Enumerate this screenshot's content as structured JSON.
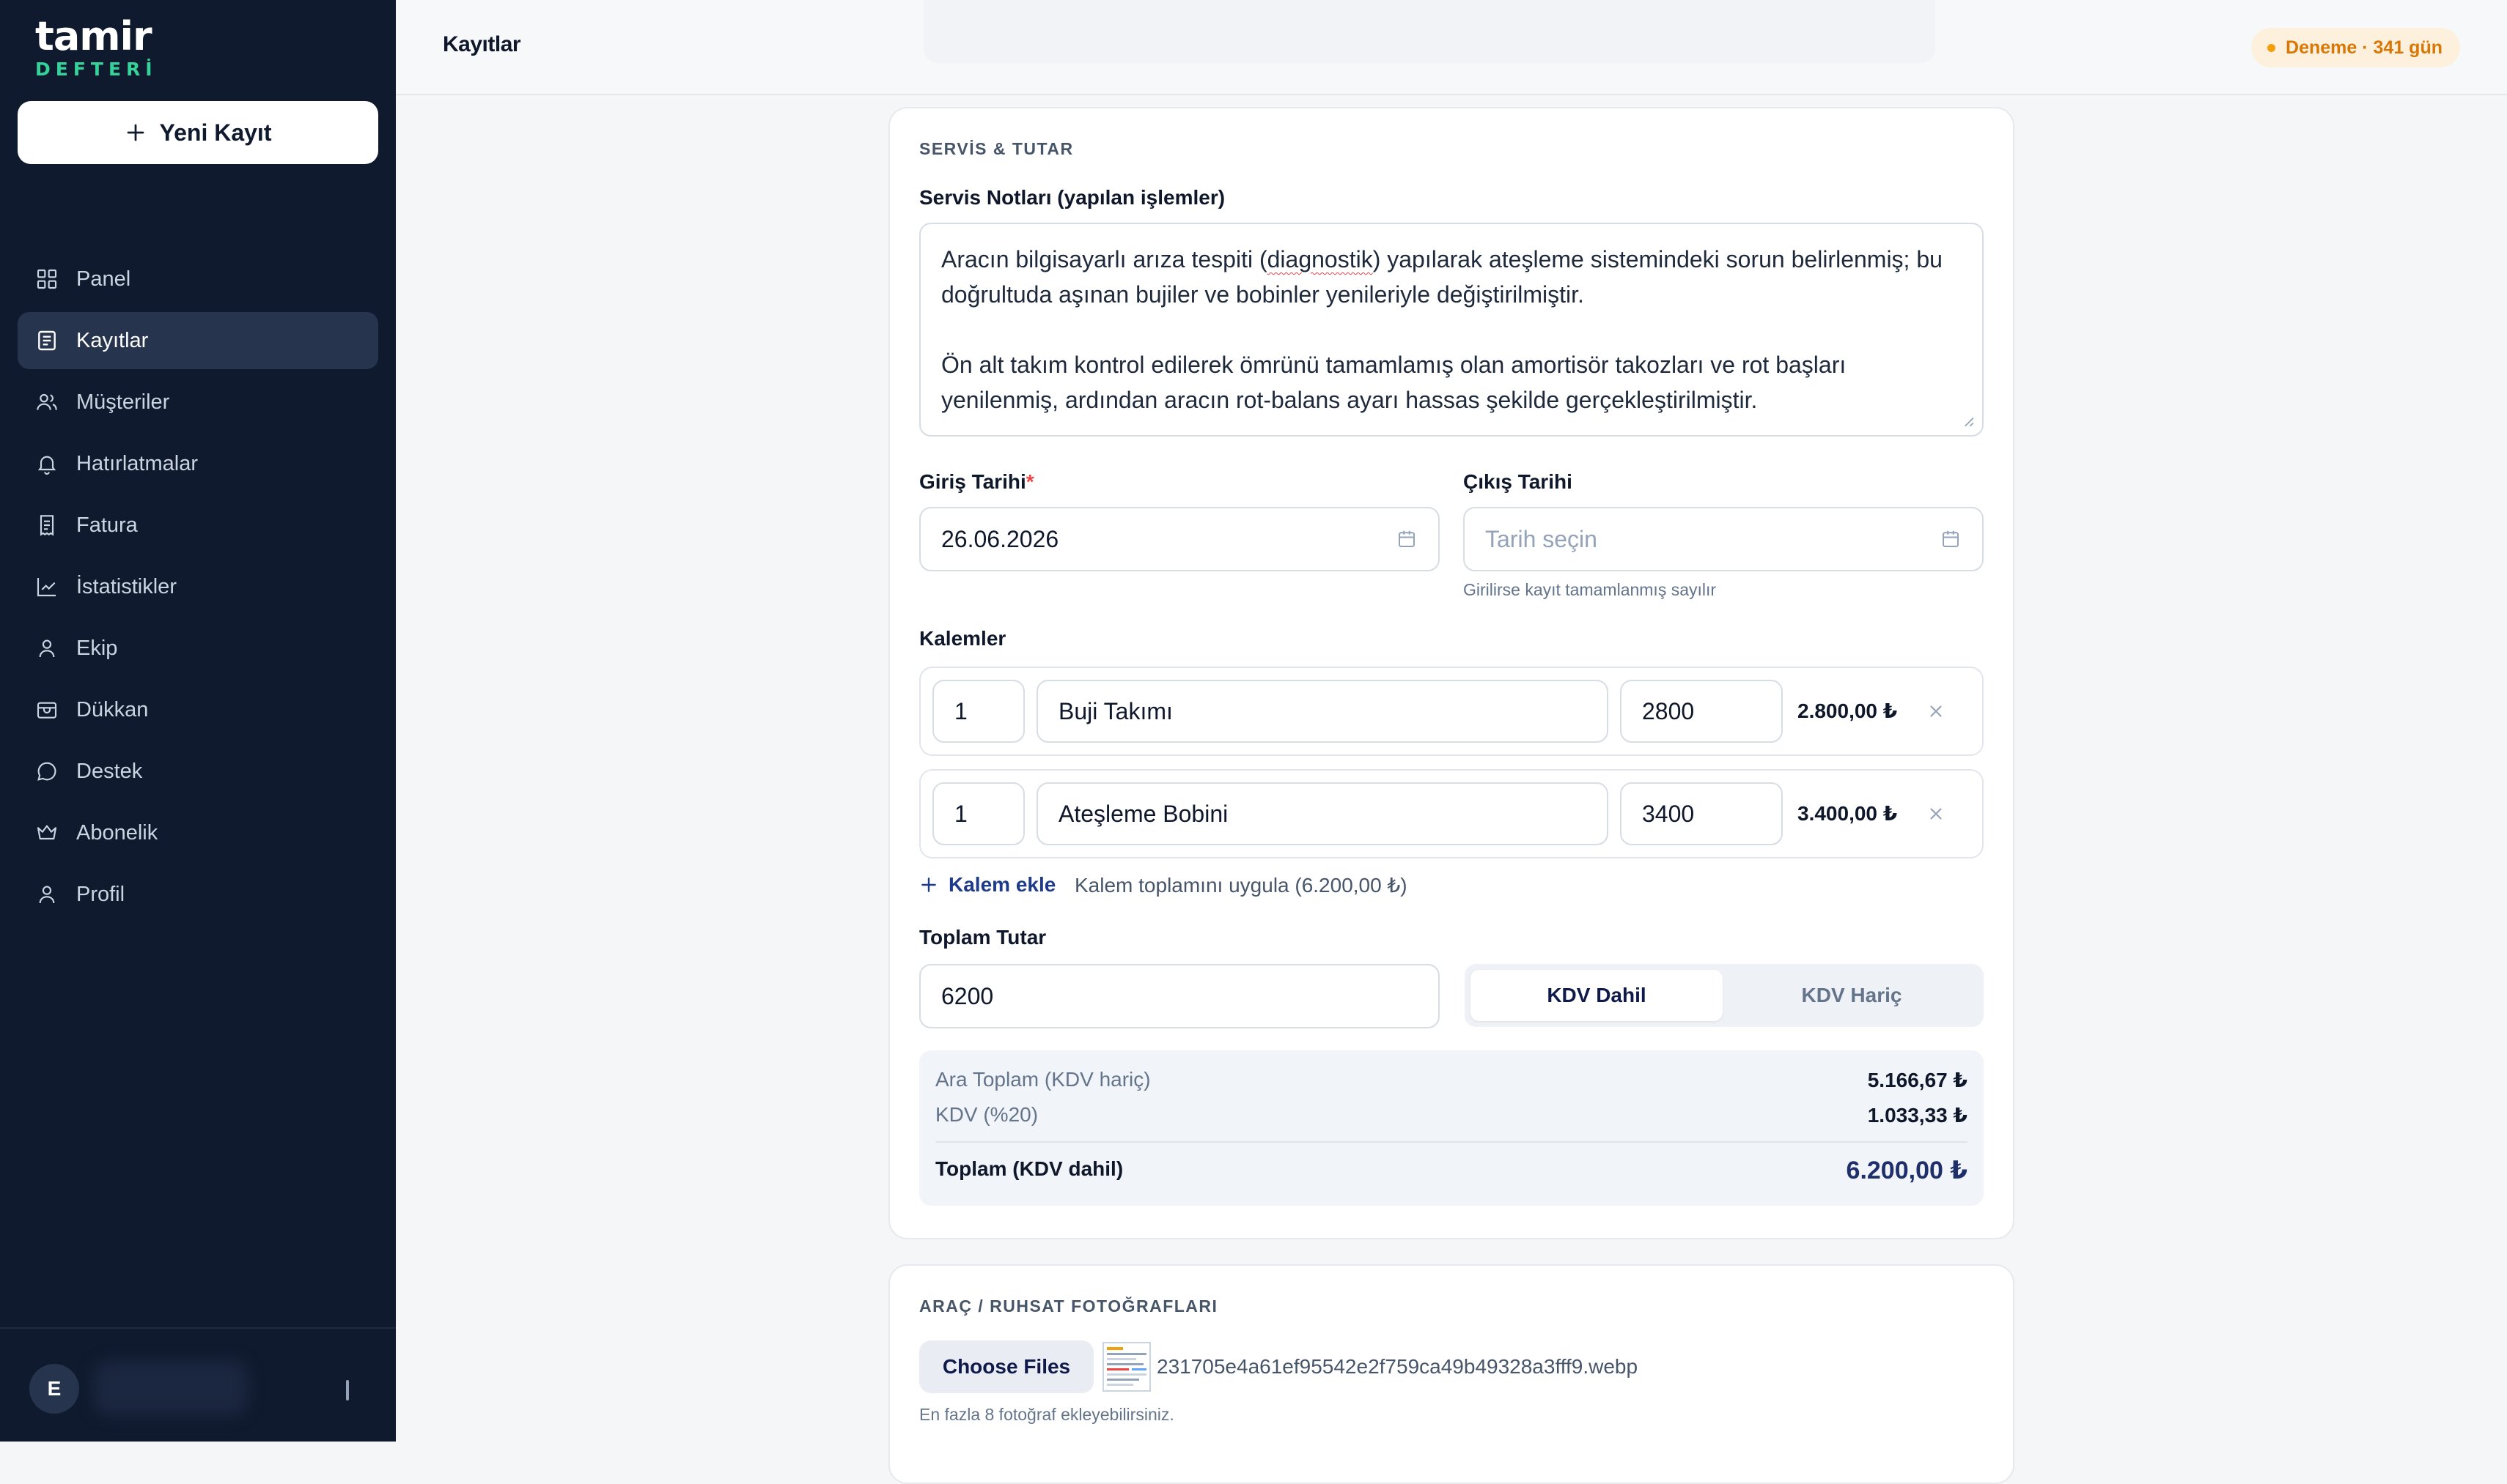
{
  "app": {
    "logo_main": "tamir",
    "logo_sub": "DEFTERİ"
  },
  "sidebar": {
    "new_button": "Yeni Kayıt",
    "items": [
      {
        "label": "Panel",
        "icon": "grid-icon"
      },
      {
        "label": "Kayıtlar",
        "icon": "document-list-icon",
        "active": true
      },
      {
        "label": "Müşteriler",
        "icon": "users-icon"
      },
      {
        "label": "Hatırlatmalar",
        "icon": "bell-icon"
      },
      {
        "label": "Fatura",
        "icon": "receipt-icon"
      },
      {
        "label": "İstatistikler",
        "icon": "chart-line-icon"
      },
      {
        "label": "Ekip",
        "icon": "user-icon"
      },
      {
        "label": "Dükkan",
        "icon": "store-icon"
      },
      {
        "label": "Destek",
        "icon": "chat-bubble-icon"
      },
      {
        "label": "Abonelik",
        "icon": "crown-icon"
      },
      {
        "label": "Profil",
        "icon": "profile-icon"
      }
    ],
    "user_initial": "E"
  },
  "header": {
    "title": "Kayıtlar",
    "trial_badge": "Deneme · 341 gün"
  },
  "service": {
    "section_title": "SERVİS & TUTAR",
    "notes_label": "Servis Notları (yapılan işlemler)",
    "notes_p1_a": "Aracın bilgisayarlı arıza tespiti (",
    "notes_p1_b": "diagnostik",
    "notes_p1_c": ") yapılarak ateşleme sistemindeki sorun belirlenmiş; bu doğrultuda aşınan bujiler ve bobinler yenileriyle değiştirilmiştir.",
    "notes_p2": "Ön alt takım kontrol edilerek ömrünü tamamlamış olan amortisör takozları ve rot başları yenilenmiş, ardından aracın rot-balans ayarı hassas şekilde gerçekleştirilmiştir.",
    "entry_date_label": "Giriş Tarihi",
    "entry_date_required": "*",
    "entry_date_value": "26.06.2026",
    "exit_date_label": "Çıkış Tarihi",
    "exit_date_placeholder": "Tarih seçin",
    "exit_date_help": "Girilirse kayıt tamamlanmış sayılır",
    "items_label": "Kalemler",
    "items": [
      {
        "qty": "1",
        "name": "Buji Takımı",
        "price": "2800",
        "total": "2.800,00 ₺"
      },
      {
        "qty": "1",
        "name": "Ateşleme Bobini",
        "price": "3400",
        "total": "3.400,00 ₺"
      }
    ],
    "add_item": "Kalem ekle",
    "apply_total": "Kalem toplamını uygula (6.200,00 ₺)",
    "total_label": "Toplam Tutar",
    "total_value": "6200",
    "vat_included": "KDV Dahil",
    "vat_excluded": "KDV Hariç",
    "subtotal_label": "Ara Toplam (KDV hariç)",
    "subtotal_value": "5.166,67 ₺",
    "vat_label": "KDV (%20)",
    "vat_value": "1.033,33 ₺",
    "grand_total_label": "Toplam (KDV dahil)",
    "grand_total_value": "6.200,00 ₺"
  },
  "photos": {
    "section_title": "ARAÇ / RUHSAT FOTOĞRAFLARI",
    "choose_button": "Choose Files",
    "file_name": "231705e4a61ef95542e2f759ca49b49328a3fff9.webp",
    "help": "En fazla 8 fotoğraf ekleyebilirsiniz."
  }
}
